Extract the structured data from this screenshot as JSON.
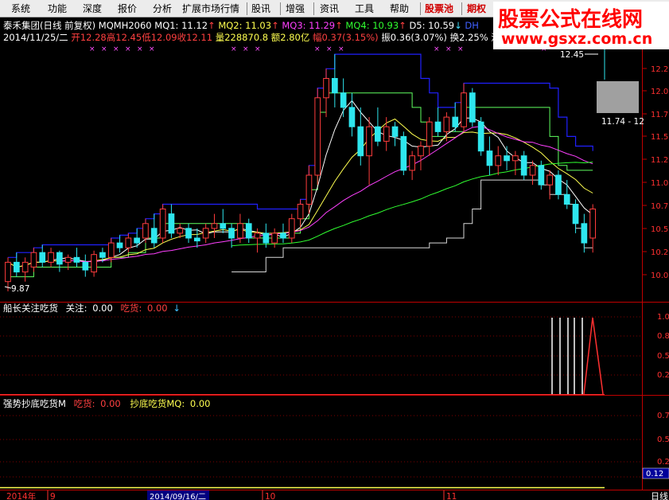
{
  "menu": [
    "系统",
    "功能",
    "深度",
    "报价",
    "分析",
    "扩展市场行情",
    "股讯",
    "增强",
    "资讯",
    "工具",
    "帮助",
    "股票池",
    "期权"
  ],
  "watermark": {
    "title": "股票公式在线网",
    "url": "www.gsxz.com.cn"
  },
  "header": {
    "title": "泰禾集团(日线 前复权)",
    "indicator_name": "MQMH2060",
    "mq1": "MQ1: 11.12",
    "mq2": "MQ2: 11.03",
    "mq3": "MQ3: 11.29",
    "mq4": "MQ4: 10.93",
    "d5": "D5: 10.59",
    "dh": "DH"
  },
  "quote": {
    "date": "2014/11/25/二",
    "open": "开12.28",
    "high": "高12.45",
    "low": "低12.09",
    "close": "收12.11",
    "volume": "量228870.8",
    "amount": "额2.80亿",
    "change": "幅0.37(3.15%)",
    "amplitude": "振0.36(3.07%)",
    "turnover": "换2.25%",
    "flow": "流"
  },
  "price_annotations": {
    "high_label": "12.45",
    "low_label": "9.87",
    "range_label": "11.74 - 12"
  },
  "price_axis": [
    "12.2",
    "12.0",
    "11.7",
    "11.5",
    "11.2",
    "11.0",
    "10.7",
    "10.5",
    "10.2",
    "10.0"
  ],
  "pane2": {
    "name": "船长关注吃货",
    "focus_label": "关注:",
    "focus_value": "0.00",
    "eat_label": "吃货:",
    "eat_value": "0.00",
    "axis": [
      "1.0",
      "0.8",
      "0.5",
      "0.2"
    ]
  },
  "pane3": {
    "name": "强势抄底吃货M",
    "eat_label": "吃货:",
    "eat_value": "0.00",
    "bottom_label": "抄底吃货MQ:",
    "bottom_value": "0.00",
    "axis": [
      "0.7",
      "0.5",
      "0.2"
    ],
    "current_value": "0.12"
  },
  "timeline": {
    "year": "2014年",
    "sept": "9",
    "date_cursor": "2014/09/16/二",
    "oct": "10",
    "nov": "11"
  },
  "period_button": "日线",
  "colors": {
    "up": "#ff3c3c",
    "down": "#2ee6ee",
    "ma_white": "#ffffff",
    "ma_yellow": "#ffff50",
    "ma_magenta": "#ff40ff",
    "ma_green": "#30ff30",
    "band_blue": "#2020ff",
    "band_green": "#60ff60",
    "grid_red": "#c00000"
  },
  "chart_data": {
    "type": "candlestick",
    "title": "泰禾集团(日线 前复权)",
    "x_start": "2014/08/18",
    "x_end": "2014/11/25",
    "ylim": [
      9.8,
      12.4
    ],
    "candles": [
      [
        10.0,
        10.25,
        9.9,
        10.2
      ],
      [
        10.2,
        10.3,
        10.05,
        10.1
      ],
      [
        10.1,
        10.25,
        10.0,
        10.2
      ],
      [
        10.15,
        10.35,
        10.1,
        10.3
      ],
      [
        10.3,
        10.38,
        10.15,
        10.2
      ],
      [
        10.2,
        10.35,
        10.15,
        10.3
      ],
      [
        10.3,
        10.32,
        10.1,
        10.18
      ],
      [
        10.2,
        10.28,
        10.12,
        10.25
      ],
      [
        10.25,
        10.35,
        10.15,
        10.2
      ],
      [
        10.2,
        10.28,
        10.05,
        10.12
      ],
      [
        10.1,
        10.32,
        10.05,
        10.28
      ],
      [
        10.3,
        10.35,
        10.2,
        10.25
      ],
      [
        10.25,
        10.45,
        10.2,
        10.4
      ],
      [
        10.4,
        10.48,
        10.3,
        10.35
      ],
      [
        10.35,
        10.5,
        10.3,
        10.45
      ],
      [
        10.45,
        10.55,
        10.35,
        10.4
      ],
      [
        10.45,
        10.65,
        10.4,
        10.6
      ],
      [
        10.55,
        10.7,
        10.35,
        10.4
      ],
      [
        10.45,
        10.8,
        10.4,
        10.75
      ],
      [
        10.7,
        10.8,
        10.45,
        10.5
      ],
      [
        10.5,
        10.6,
        10.45,
        10.55
      ],
      [
        10.55,
        10.6,
        10.4,
        10.45
      ],
      [
        10.45,
        10.55,
        10.35,
        10.42
      ],
      [
        10.45,
        10.6,
        10.4,
        10.55
      ],
      [
        10.55,
        10.7,
        10.45,
        10.6
      ],
      [
        10.6,
        10.75,
        10.5,
        10.55
      ],
      [
        10.55,
        10.6,
        10.35,
        10.45
      ],
      [
        10.45,
        10.7,
        10.4,
        10.6
      ],
      [
        10.6,
        10.65,
        10.4,
        10.45
      ],
      [
        10.45,
        10.55,
        10.3,
        10.5
      ],
      [
        10.5,
        10.6,
        10.35,
        10.4
      ],
      [
        10.4,
        10.55,
        10.35,
        10.5
      ],
      [
        10.5,
        10.6,
        10.4,
        10.45
      ],
      [
        10.45,
        10.7,
        10.4,
        10.65
      ],
      [
        10.65,
        10.85,
        10.55,
        10.8
      ],
      [
        10.8,
        11.2,
        10.7,
        11.1
      ],
      [
        11.1,
        12.0,
        11.0,
        11.9
      ],
      [
        11.9,
        12.2,
        11.7,
        12.1
      ],
      [
        12.1,
        12.35,
        11.8,
        11.95
      ],
      [
        11.95,
        12.1,
        11.7,
        11.8
      ],
      [
        11.8,
        11.95,
        11.5,
        11.6
      ],
      [
        11.6,
        11.8,
        11.2,
        11.3
      ],
      [
        11.3,
        11.7,
        11.0,
        11.6
      ],
      [
        11.6,
        11.8,
        11.4,
        11.45
      ],
      [
        11.45,
        11.7,
        11.35,
        11.6
      ],
      [
        11.6,
        11.65,
        11.4,
        11.5
      ],
      [
        11.5,
        11.55,
        11.1,
        11.15
      ],
      [
        11.15,
        11.35,
        11.05,
        11.3
      ],
      [
        11.3,
        11.45,
        11.15,
        11.4
      ],
      [
        11.4,
        11.7,
        11.3,
        11.65
      ],
      [
        11.65,
        11.8,
        11.5,
        11.55
      ],
      [
        11.55,
        11.75,
        11.45,
        11.7
      ],
      [
        11.7,
        11.85,
        11.55,
        11.6
      ],
      [
        11.6,
        12.05,
        11.55,
        11.95
      ],
      [
        11.95,
        12.0,
        11.6,
        11.65
      ],
      [
        11.65,
        11.7,
        11.3,
        11.35
      ],
      [
        11.35,
        11.5,
        11.1,
        11.2
      ],
      [
        11.2,
        11.4,
        11.1,
        11.3
      ],
      [
        11.3,
        11.4,
        11.15,
        11.25
      ],
      [
        11.25,
        11.35,
        11.1,
        11.3
      ],
      [
        11.3,
        11.35,
        11.05,
        11.1
      ],
      [
        11.1,
        11.25,
        11.0,
        11.2
      ],
      [
        11.2,
        11.25,
        10.95,
        11.0
      ],
      [
        11.0,
        11.15,
        10.85,
        11.1
      ],
      [
        11.1,
        11.15,
        10.85,
        10.9
      ],
      [
        10.9,
        11.05,
        10.75,
        10.8
      ],
      [
        10.8,
        10.85,
        10.5,
        10.6
      ],
      [
        10.6,
        10.7,
        10.3,
        10.4
      ],
      [
        10.45,
        10.8,
        10.3,
        10.75
      ],
      [
        12.28,
        12.45,
        12.09,
        12.11
      ]
    ]
  }
}
